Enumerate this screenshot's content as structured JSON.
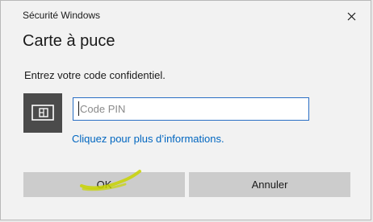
{
  "window": {
    "title": "Sécurité Windows"
  },
  "dialog": {
    "heading": "Carte à puce",
    "prompt": "Entrez votre code confidentiel.",
    "pin_placeholder": "Code PIN",
    "pin_value": "",
    "more_info_link": "Cliquez pour plus d’informations."
  },
  "buttons": {
    "ok_label": "OK",
    "cancel_label": "Annuler"
  },
  "icons": {
    "close": "close-icon",
    "card": "smart-card-icon"
  },
  "colors": {
    "background": "#f2f2f2",
    "link": "#0066c0",
    "input_border": "#2a6fc4",
    "button": "#cccccc",
    "card_tile": "#4b4b4b",
    "highlight": "#c8d400"
  }
}
